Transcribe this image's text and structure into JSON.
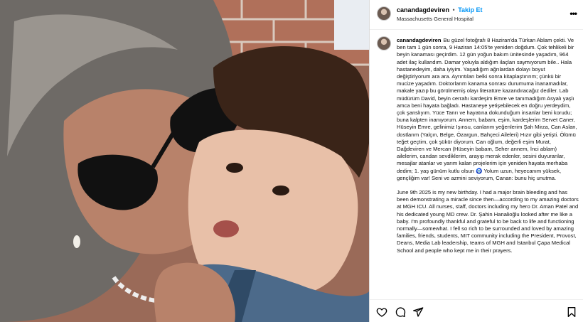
{
  "header": {
    "username": "canandagdeviren",
    "separator": "•",
    "follow_label": "Takip Et",
    "location": "Massachusetts General Hospital",
    "more_icon": "more-dots-icon"
  },
  "caption": {
    "username": "canandagdeviren",
    "paragraph_tr": "Bu güzel fotoğrafı 8 Haziran'da Türkan Ablam çekti. Ve ben tam 1 gün sonra, 9 Haziran 14:05'te yeniden doğdum. Çok tehlikeli bir beyin kanaması geçirdim. 12 gün yoğun bakım ünitesinde yaşadım, 964 adet ilaç kullandım. Damar yoluyla aldığım ilaçları saymıyorum bile.. Hala hastanedeyim, daha iyiyim. Yaşadığım ağrılardan dolayı boyut değiştiriyorum ara ara. Ayrıntıları belki sonra kitaplaştırırım; çünkü bir mucize yaşadım. Doktorlarım kanama sonrası durumuma inanamadılar, makale yazıp bu görülmemiş olayı literatüre kazandıracağız dediler. Lab müdürüm David, beyin cerrahı kardeşim Emre ve tanımadığım Asyalı yaşlı amca beni hayata bağladı. Hastaneye yetişebilecek en doğru yerdeydim, çok şanslıyım. Yüce Tanrı ve hayatına dokunduğum insanlar beni korudu; buna kalpten inanıyorum. Annem, babam, eşim, kardeşlerim Servet Caner, Hüseyin Emre, gelinimiz Işınsu, canlarım yeğenlerim Şah Mirza, Can Aslan, dostlarım (Yalçın, Belge, Özargun, Bahçeci Aileleri) Hızır gibi yetişti. Ölümü teğet geçtim, çok şükür diyorum. Can oğlum, değerli eşim Murat, Dağdeviren ve Mercan (Hüseyin babam, Seher annem, İnci ablam) ailelerim, candan sevdiklerim, arayıp merak edenler, sesini duyuranlar, mesajlar atanlar ve yarım kalan projelerim için yeniden hayata merhaba dedim; 1. yaş günüm kutlu olsun 🧿 Yolum uzun, heyecanım yüksek, gençliğim var! Seni ve azmini seviyorum, Canan: bunu hiç unutma.",
    "paragraph_en": "June 9th 2025 is my new birthday. I had a major brain bleeding and has been demonstrating a miracle since then—according to my amazing doctors at MGH ICU. All nurses, staff, doctors including my hero Dr. Aman Patel and his dedicated young MD crew. Dr. Şahin Hanalioğlu looked after me like a baby. I'm profoundly thankful and grateful to be back to life and functioning normally—somewhat. I fell so rich to be surrounded and loved by amazing families, friends, students, MIT community including the President, Provost, Deans, Media Lab leadership, teams of MGH and İstanbul Çapa Medical School and people who kept me in their prayers."
  },
  "actions": {
    "like_icon": "heart-icon",
    "comment_icon": "comment-icon",
    "share_icon": "share-icon",
    "save_icon": "bookmark-icon"
  },
  "colors": {
    "accent": "#0095f6",
    "border": "#dbdbdb"
  }
}
